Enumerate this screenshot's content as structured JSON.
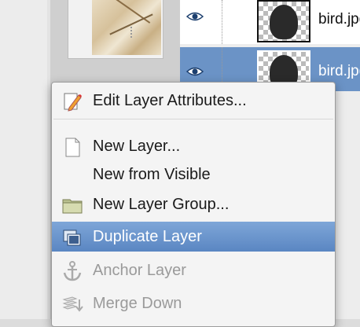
{
  "layers": [
    {
      "name": "bird.jpg",
      "selected": false
    },
    {
      "name": "bird.jpg",
      "selected": true
    }
  ],
  "context_menu": {
    "items": [
      {
        "label": "Edit Layer Attributes...",
        "icon": "pencil-icon",
        "enabled": true,
        "active": false
      },
      {
        "label": "New Layer...",
        "icon": "document-icon",
        "enabled": true,
        "active": false
      },
      {
        "label": "New from Visible",
        "icon": "",
        "enabled": true,
        "active": false
      },
      {
        "label": "New Layer Group...",
        "icon": "folder-icon",
        "enabled": true,
        "active": false
      },
      {
        "label": "Duplicate Layer",
        "icon": "duplicate-layer-icon",
        "enabled": true,
        "active": true
      },
      {
        "label": "Anchor Layer",
        "icon": "anchor-icon",
        "enabled": false,
        "active": false
      },
      {
        "label": "Merge Down",
        "icon": "merge-down-icon",
        "enabled": false,
        "active": false
      }
    ]
  },
  "colors": {
    "selection": "#6b93c6",
    "menu_highlight": "#5a86c2"
  }
}
